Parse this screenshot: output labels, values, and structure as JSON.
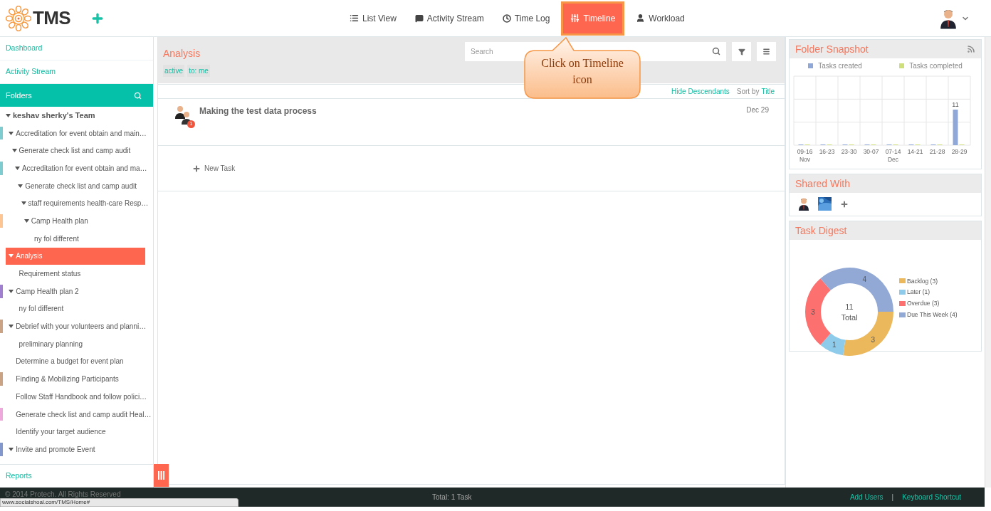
{
  "header": {
    "logo_text": "TMS",
    "tabs": [
      {
        "label": "List View",
        "selected": false
      },
      {
        "label": "Activity Stream",
        "selected": false
      },
      {
        "label": "Time Log",
        "selected": false
      },
      {
        "label": "Timeline",
        "selected": true
      },
      {
        "label": "Workload",
        "selected": false
      }
    ]
  },
  "callout": {
    "text": "Click on Timeline icon"
  },
  "sidebar": {
    "nav": [
      {
        "label": "Dashboard"
      },
      {
        "label": "Activity Stream"
      }
    ],
    "folders_title": "Folders",
    "tree": [
      {
        "label": "keshav sherky's Team",
        "expanded": true,
        "selected": false,
        "children": [
          {
            "label": "Accreditation for event obtain and main…",
            "expanded": true,
            "selected": false,
            "color": "#7ecbd0",
            "children": [
              {
                "label": "Generate check list and camp audit",
                "expanded": true,
                "selected": false,
                "children": [
                  {
                    "label": "Accreditation for event obtain and ma…",
                    "expanded": true,
                    "selected": false,
                    "color": "#7ecbd0",
                    "children": [
                      {
                        "label": "Generate check list and camp audit",
                        "expanded": true,
                        "selected": false,
                        "children": [
                          {
                            "label": "staff requirements health-care Resp…",
                            "expanded": true,
                            "selected": false,
                            "children": [
                              {
                                "label": "Camp Health plan",
                                "expanded": true,
                                "selected": false,
                                "color": "#fdc592",
                                "children": [
                                  {
                                    "label": "ny fol different",
                                    "selected": false
                                  }
                                ]
                              }
                            ]
                          }
                        ]
                      }
                    ]
                  }
                ]
              }
            ]
          },
          {
            "label": "Analysis",
            "expanded": true,
            "selected": true,
            "children": [
              {
                "label": "Requirement status",
                "selected": false
              }
            ]
          },
          {
            "label": "Camp Health plan 2",
            "expanded": true,
            "selected": false,
            "color": "#a07ed0",
            "children": [
              {
                "label": "ny fol different",
                "selected": false
              }
            ]
          },
          {
            "label": "Debrief with your volunteers and planni…",
            "expanded": true,
            "selected": false,
            "color": "#c9a383",
            "children": [
              {
                "label": "preliminary planning",
                "selected": false
              }
            ]
          },
          {
            "label": "Determine a budget for event plan",
            "selected": false
          },
          {
            "label": "Finding & Mobilizing Participants",
            "selected": false,
            "color": "#c9a383"
          },
          {
            "label": "Follow Staff Handbook and follow polici…",
            "selected": false
          },
          {
            "label": "Generate check list and camp audit Heal…",
            "selected": false,
            "color": "#eea8dc"
          },
          {
            "label": "Identify your target audience",
            "selected": false
          },
          {
            "label": "Invite and promote Event",
            "expanded": true,
            "selected": false,
            "color": "#8298cc"
          }
        ]
      }
    ],
    "reports": "Reports"
  },
  "main": {
    "title": "Analysis",
    "filters": [
      "active",
      "to: me"
    ],
    "search": {
      "placeholder": "Search"
    },
    "hide_descendants": "Hide Descendants",
    "sort_label": "Sort by",
    "sort_value": "Title",
    "tasks": [
      {
        "title": "Making the test data process",
        "date": "Dec 29",
        "badge": "1"
      }
    ],
    "new_task": "New Task"
  },
  "snapshot": {
    "title": "Folder Snapshot",
    "chart_data": {
      "type": "bar",
      "categories": [
        "09-16\nNov",
        "16-23",
        "23-30",
        "30-07",
        "07-14\nDec",
        "14-21",
        "21-28",
        "28-29"
      ],
      "series": [
        {
          "name": "Tasks created",
          "color": "#8fa8d8",
          "values": [
            0,
            0,
            0,
            0,
            0,
            0,
            0,
            11
          ],
          "value_labels": [
            null,
            null,
            null,
            null,
            null,
            null,
            null,
            "11"
          ]
        },
        {
          "name": "Tasks completed",
          "color": "#cfe07a",
          "values": [
            0,
            0,
            0,
            0,
            0,
            0,
            0,
            0
          ],
          "value_labels": [
            null,
            null,
            null,
            null,
            null,
            null,
            null,
            null
          ]
        }
      ],
      "legend": "top"
    }
  },
  "shared": {
    "title": "Shared With",
    "members": [
      {
        "kind": "person"
      },
      {
        "kind": "picture"
      }
    ]
  },
  "digest": {
    "title": "Task Digest",
    "total": "11",
    "total_label": "Total",
    "chart_data": {
      "type": "donut",
      "categories": [
        "Backlog (3)",
        "Later (1)",
        "Overdue (3)",
        "Due This Week (4)"
      ],
      "values": [
        3,
        1,
        3,
        4
      ],
      "colors": [
        "#ecb85c",
        "#8ecbea",
        "#fd7070",
        "#92a9d6"
      ],
      "data_labels": true,
      "legend": "right"
    }
  },
  "footer": {
    "copyright": "© 2014 Protech. All Rights Reserved",
    "total": "Total: 1 Task",
    "links": [
      "Add Users",
      "Keyboard Shortcut"
    ],
    "separator": "|"
  },
  "status_url": "www.socialshoal.com/TMS/Home#"
}
